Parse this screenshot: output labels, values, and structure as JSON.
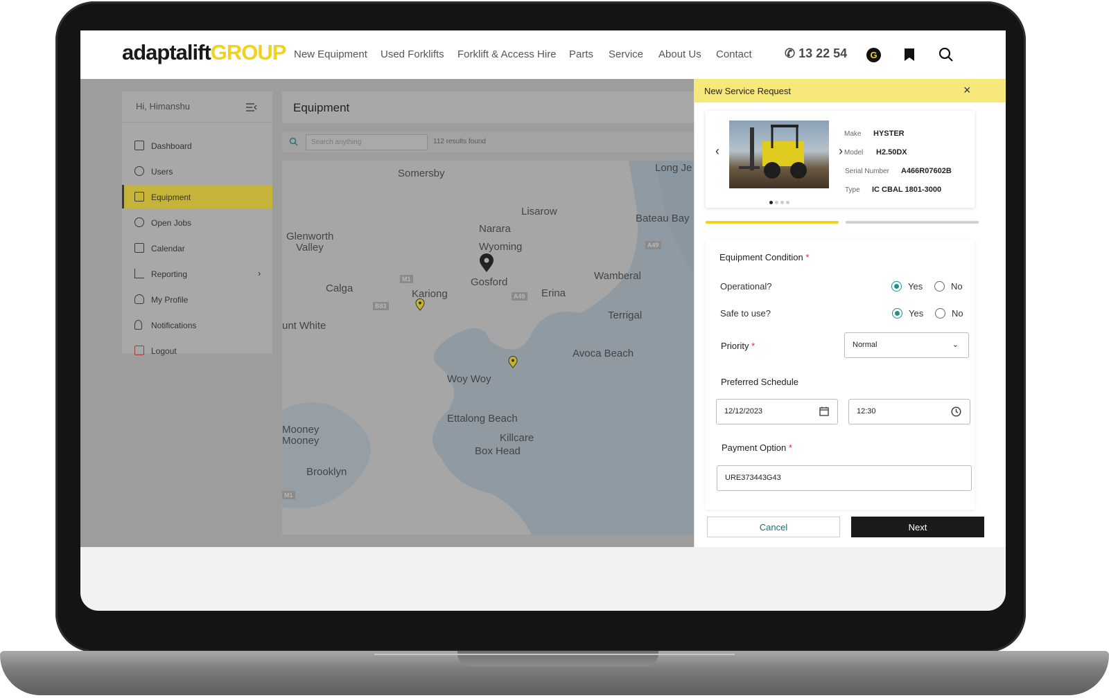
{
  "brand": {
    "logo_main": "adaptalift",
    "logo_group": "GROUP",
    "accent": "#f2d31b"
  },
  "nav": {
    "items": [
      "New Equipment",
      "Used Forklifts",
      "Forklift & Access Hire",
      "Parts",
      "Service",
      "About Us",
      "Contact"
    ],
    "phone": "13 22 54",
    "g_badge": "G"
  },
  "sidebar": {
    "greeting": "Hi, Himanshu",
    "items": [
      {
        "label": "Dashboard",
        "icon": "dashboard-icon"
      },
      {
        "label": "Users",
        "icon": "users-icon"
      },
      {
        "label": "Equipment",
        "icon": "forklift-icon",
        "active": true
      },
      {
        "label": "Open Jobs",
        "icon": "jobs-icon"
      },
      {
        "label": "Calendar",
        "icon": "calendar-icon"
      },
      {
        "label": "Reporting",
        "icon": "chart-icon",
        "has_submenu": true
      },
      {
        "label": "My Profile",
        "icon": "profile-icon"
      },
      {
        "label": "Notifications",
        "icon": "bell-icon"
      },
      {
        "label": "Logout",
        "icon": "logout-icon"
      }
    ]
  },
  "equipment": {
    "title": "Equipment",
    "search_placeholder": "Search anything",
    "results": "112 results found"
  },
  "map": {
    "places": [
      "Somersby",
      "Long Je",
      "Lisarow",
      "Narara",
      "Glenworth",
      "Valley",
      "Wyoming",
      "Bateau Bay",
      "Gosford",
      "Calga",
      "Kariong",
      "Erina",
      "Wamberal",
      "Terrigal",
      "unt White",
      "Avoca Beach",
      "Woy Woy",
      "Ettalong Beach",
      "Killcare",
      "Box Head",
      "Mooney",
      "Mooney",
      "Brooklyn"
    ],
    "roads": [
      "M1",
      "B83",
      "A49",
      "A49",
      "M1"
    ]
  },
  "modal": {
    "title": "New Service Request",
    "equipment": {
      "make_label": "Make",
      "make": "HYSTER",
      "model_label": "Model",
      "model": "H2.50DX",
      "serial_label": "Serial Number",
      "serial": "A466R07602B",
      "type_label": "Type",
      "type": "IC CBAL 1801-3000"
    },
    "condition": {
      "title": "Equipment Condition",
      "operational_q": "Operational?",
      "safe_q": "Safe to use?",
      "yes": "Yes",
      "no": "No",
      "operational_value": "Yes",
      "safe_value": "Yes"
    },
    "priority_label": "Priority",
    "priority_value": "Normal",
    "schedule_label": "Preferred Schedule",
    "date_value": "12/12/2023",
    "time_value": "12:30",
    "payment_label": "Payment Option",
    "payment_value": "URE373443G43",
    "required_mark": "*",
    "cancel": "Cancel",
    "next": "Next",
    "step": 1,
    "steps_total": 2
  }
}
